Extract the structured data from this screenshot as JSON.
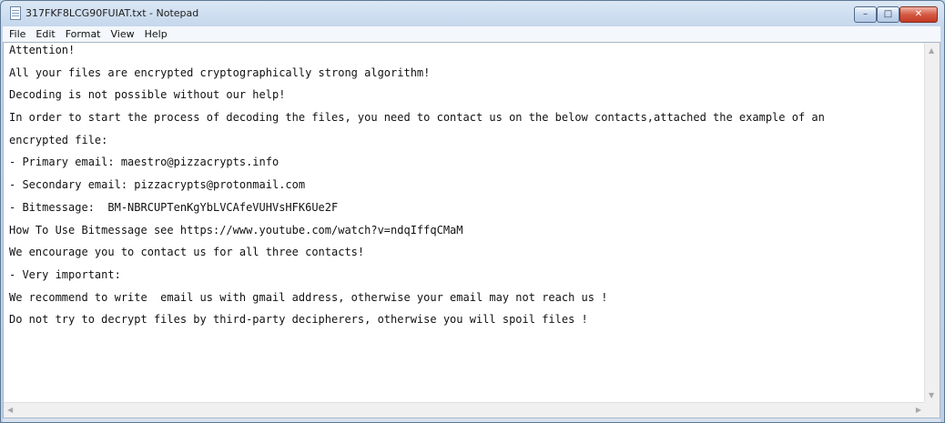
{
  "window": {
    "title": "317FKF8LCG90FUIAT.txt - Notepad",
    "controls": {
      "minimize": "–",
      "maximize": "□",
      "close": "✕"
    }
  },
  "menu": [
    "File",
    "Edit",
    "Format",
    "View",
    "Help"
  ],
  "document": {
    "lines": [
      "Attention!",
      "All your files are encrypted cryptographically strong algorithm!",
      "Decoding is not possible without our help!",
      "In order to start the process of decoding the files, you need to contact us on the below contacts,attached the example of an",
      "encrypted file:",
      "- Primary email: maestro@pizzacrypts.info",
      "- Secondary email: pizzacrypts@protonmail.com",
      "- Bitmessage:  BM-NBRCUPTenKgYbLVCAfeVUHVsHFK6Ue2F",
      "How To Use Bitmessage see https://www.youtube.com/watch?v=ndqIffqCMaM",
      "We encourage you to contact us for all three contacts!",
      "- Very important:",
      "We recommend to write  email us with gmail address, otherwise your email may not reach us !",
      "Do not try to decrypt files by third-party decipherers, otherwise you will spoil files !"
    ]
  },
  "scrollbars": {
    "up": "▲",
    "down": "▼",
    "left": "◀",
    "right": "▶"
  }
}
